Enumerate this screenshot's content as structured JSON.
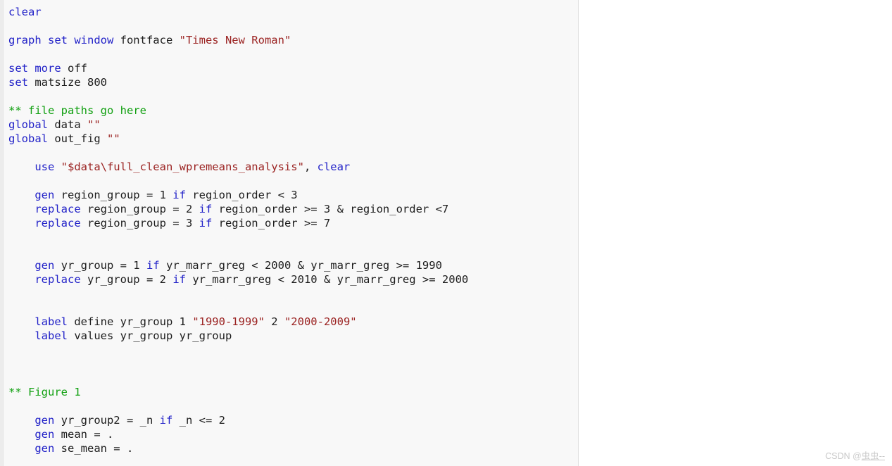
{
  "editor": {
    "language": "stata",
    "colors": {
      "keyword": "#2222c8",
      "string": "#9b2322",
      "comment": "#11a011",
      "text": "#1c1c1c",
      "background": "#f8f8f8",
      "gutter": "#ececec",
      "divider": "#dfdfdf"
    },
    "lines": [
      {
        "indent": 0,
        "tokens": [
          {
            "c": "kw",
            "t": "clear"
          }
        ]
      },
      {
        "indent": 0,
        "tokens": []
      },
      {
        "indent": 0,
        "tokens": [
          {
            "c": "kw",
            "t": "graph set window "
          },
          {
            "c": "txt",
            "t": "fontface "
          },
          {
            "c": "str",
            "t": "\"Times New Roman\""
          }
        ]
      },
      {
        "indent": 0,
        "tokens": []
      },
      {
        "indent": 0,
        "tokens": [
          {
            "c": "kw",
            "t": "set more "
          },
          {
            "c": "txt",
            "t": "off"
          }
        ]
      },
      {
        "indent": 0,
        "tokens": [
          {
            "c": "kw",
            "t": "set "
          },
          {
            "c": "txt",
            "t": "matsize 800"
          }
        ]
      },
      {
        "indent": 0,
        "tokens": []
      },
      {
        "indent": 0,
        "tokens": [
          {
            "c": "cmt",
            "t": "** file paths go here"
          }
        ]
      },
      {
        "indent": 0,
        "tokens": [
          {
            "c": "kw",
            "t": "global "
          },
          {
            "c": "txt",
            "t": "data "
          },
          {
            "c": "str",
            "t": "\"\""
          }
        ]
      },
      {
        "indent": 0,
        "tokens": [
          {
            "c": "kw",
            "t": "global "
          },
          {
            "c": "txt",
            "t": "out_fig "
          },
          {
            "c": "str",
            "t": "\"\""
          }
        ]
      },
      {
        "indent": 0,
        "tokens": []
      },
      {
        "indent": 4,
        "tokens": [
          {
            "c": "kw",
            "t": "use "
          },
          {
            "c": "str",
            "t": "\"$data\\full_clean_wpremeans_analysis\""
          },
          {
            "c": "txt",
            "t": ", "
          },
          {
            "c": "kw",
            "t": "clear"
          }
        ]
      },
      {
        "indent": 0,
        "tokens": []
      },
      {
        "indent": 4,
        "tokens": [
          {
            "c": "kw",
            "t": "gen "
          },
          {
            "c": "txt",
            "t": "region_group = 1 "
          },
          {
            "c": "kw",
            "t": "if "
          },
          {
            "c": "txt",
            "t": "region_order < 3"
          }
        ]
      },
      {
        "indent": 4,
        "tokens": [
          {
            "c": "kw",
            "t": "replace "
          },
          {
            "c": "txt",
            "t": "region_group = 2 "
          },
          {
            "c": "kw",
            "t": "if "
          },
          {
            "c": "txt",
            "t": "region_order >= 3 & region_order <7"
          }
        ]
      },
      {
        "indent": 4,
        "tokens": [
          {
            "c": "kw",
            "t": "replace "
          },
          {
            "c": "txt",
            "t": "region_group = 3 "
          },
          {
            "c": "kw",
            "t": "if "
          },
          {
            "c": "txt",
            "t": "region_order >= 7"
          }
        ]
      },
      {
        "indent": 0,
        "tokens": []
      },
      {
        "indent": 0,
        "tokens": []
      },
      {
        "indent": 4,
        "tokens": [
          {
            "c": "kw",
            "t": "gen "
          },
          {
            "c": "txt",
            "t": "yr_group = 1 "
          },
          {
            "c": "kw",
            "t": "if "
          },
          {
            "c": "txt",
            "t": "yr_marr_greg < 2000 & yr_marr_greg >= 1990"
          }
        ]
      },
      {
        "indent": 4,
        "tokens": [
          {
            "c": "kw",
            "t": "replace "
          },
          {
            "c": "txt",
            "t": "yr_group = 2 "
          },
          {
            "c": "kw",
            "t": "if "
          },
          {
            "c": "txt",
            "t": "yr_marr_greg < 2010 & yr_marr_greg >= 2000"
          }
        ]
      },
      {
        "indent": 0,
        "tokens": []
      },
      {
        "indent": 0,
        "tokens": []
      },
      {
        "indent": 4,
        "tokens": [
          {
            "c": "kw",
            "t": "label "
          },
          {
            "c": "txt",
            "t": "define yr_group 1 "
          },
          {
            "c": "str",
            "t": "\"1990-1999\""
          },
          {
            "c": "txt",
            "t": " 2 "
          },
          {
            "c": "str",
            "t": "\"2000-2009\""
          }
        ]
      },
      {
        "indent": 4,
        "tokens": [
          {
            "c": "kw",
            "t": "label "
          },
          {
            "c": "txt",
            "t": "values yr_group yr_group"
          }
        ]
      },
      {
        "indent": 0,
        "tokens": []
      },
      {
        "indent": 0,
        "tokens": []
      },
      {
        "indent": 0,
        "tokens": []
      },
      {
        "indent": 0,
        "tokens": [
          {
            "c": "cmt",
            "t": "** Figure 1"
          }
        ]
      },
      {
        "indent": 0,
        "tokens": []
      },
      {
        "indent": 4,
        "tokens": [
          {
            "c": "kw",
            "t": "gen "
          },
          {
            "c": "txt",
            "t": "yr_group2 = _n "
          },
          {
            "c": "kw",
            "t": "if "
          },
          {
            "c": "txt",
            "t": "_n <= 2"
          }
        ]
      },
      {
        "indent": 4,
        "tokens": [
          {
            "c": "kw",
            "t": "gen "
          },
          {
            "c": "txt",
            "t": "mean = ."
          }
        ]
      },
      {
        "indent": 4,
        "tokens": [
          {
            "c": "kw",
            "t": "gen "
          },
          {
            "c": "txt",
            "t": "se_mean = ."
          }
        ]
      }
    ]
  },
  "watermark": {
    "prefix": "CSDN @",
    "user": "虫虫--"
  }
}
